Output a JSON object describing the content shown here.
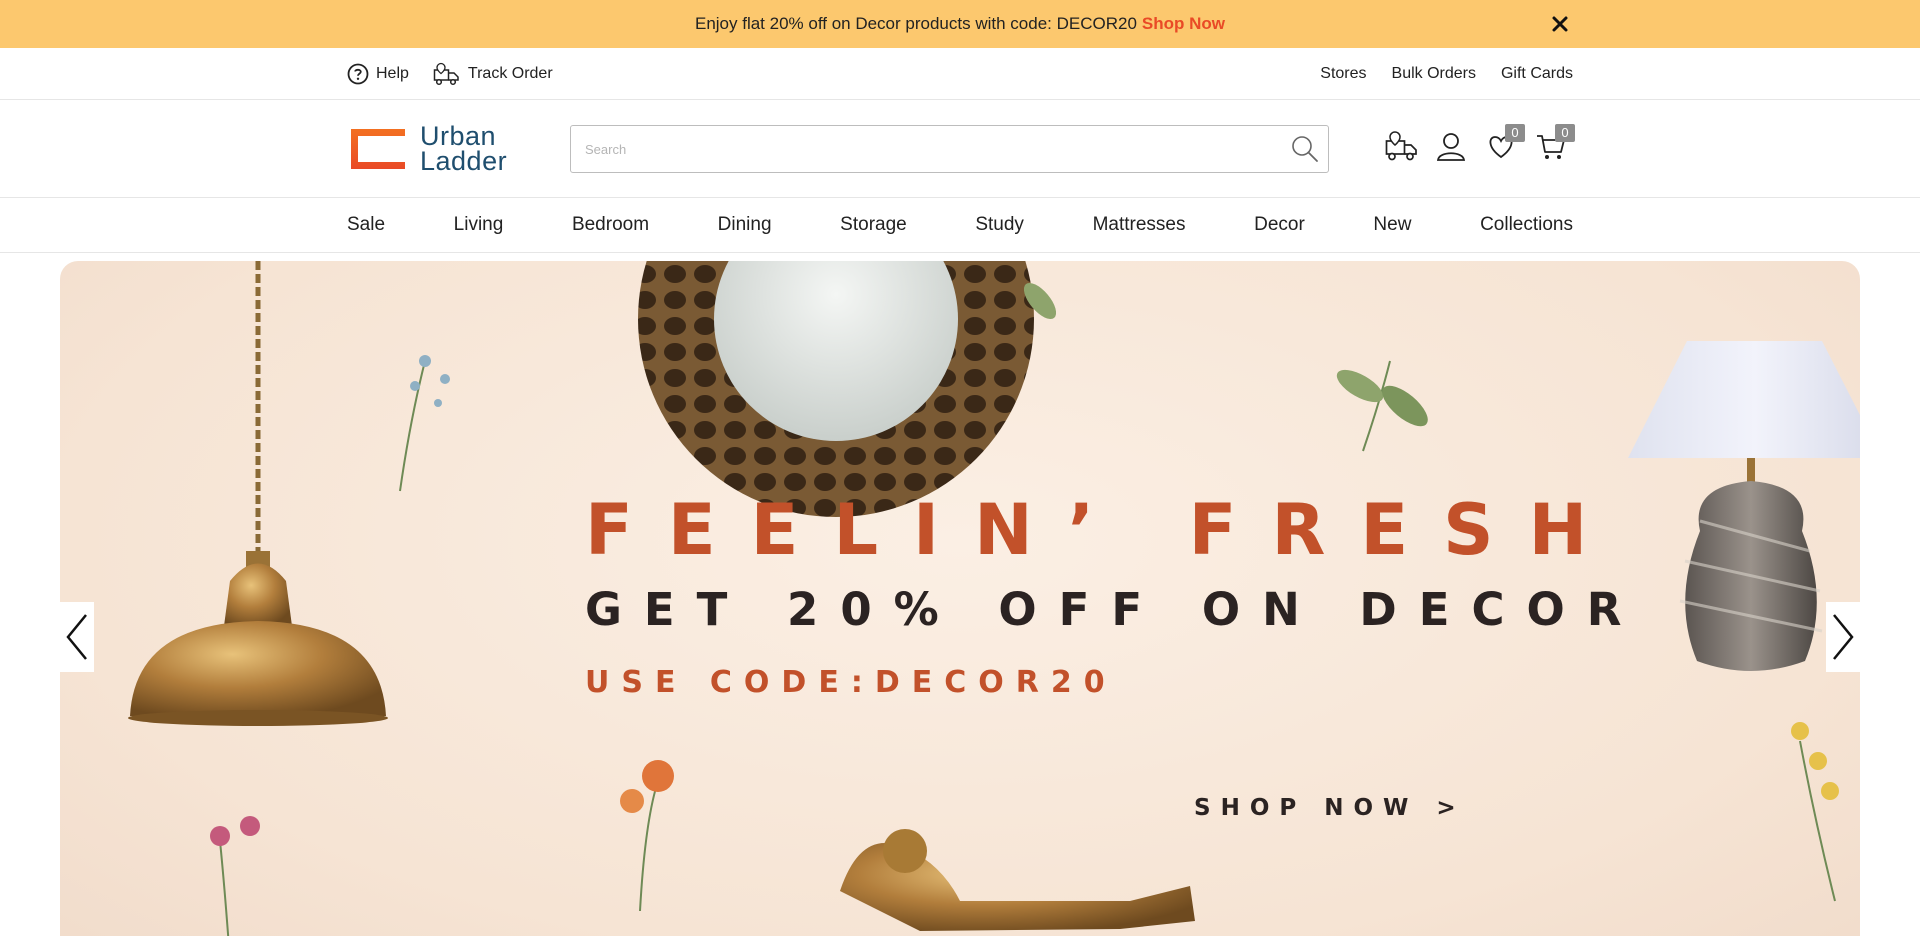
{
  "promo": {
    "text": "Enjoy flat 20% off on Decor products with code: DECOR20",
    "link": "Shop Now",
    "close_icon": "close-icon"
  },
  "utility": {
    "help": "Help",
    "track_order": "Track Order",
    "stores": "Stores",
    "bulk_orders": "Bulk Orders",
    "gift_cards": "Gift Cards"
  },
  "header": {
    "logo_line1": "Urban",
    "logo_line2": "Ladder",
    "search_placeholder": "Search",
    "wishlist_count": "0",
    "cart_count": "0",
    "icons": [
      "track-order-icon",
      "user-icon",
      "wishlist-icon",
      "cart-icon"
    ]
  },
  "nav": {
    "items": [
      "Sale",
      "Living",
      "Bedroom",
      "Dining",
      "Storage",
      "Study",
      "Mattresses",
      "Decor",
      "New",
      "Collections"
    ]
  },
  "hero": {
    "headline": "FEELIN’ FRESH",
    "subheadline": "GET 20% OFF ON DECOR",
    "code_line": "USE CODE:DECOR20",
    "cta": "SHOP NOW >"
  },
  "colors": {
    "promo_bg": "#fcc86e",
    "accent": "#e94a26",
    "brand": "#1f4e6e",
    "hero_red": "#c2512a"
  }
}
